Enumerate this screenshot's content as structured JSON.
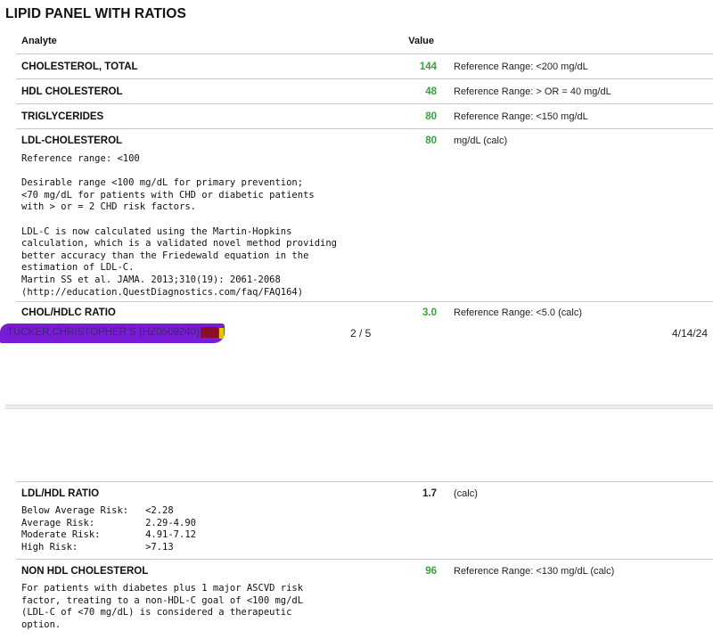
{
  "title": "LIPID PANEL WITH RATIOS",
  "header": {
    "analyte": "Analyte",
    "value": "Value"
  },
  "tests": [
    {
      "name": "CHOLESTEROL, TOTAL",
      "value": "144",
      "ref": "Reference Range: <200 mg/dL"
    },
    {
      "name": "HDL CHOLESTEROL",
      "value": "48",
      "ref": "Reference Range: > OR = 40 mg/dL"
    },
    {
      "name": "TRIGLYCERIDES",
      "value": "80",
      "ref": "Reference Range: <150 mg/dL"
    },
    {
      "name": "LDL-CHOLESTEROL",
      "value": "80",
      "ref": "mg/dL (calc)",
      "note": "Reference range: <100\n\nDesirable range <100 mg/dL for primary prevention;\n<70 mg/dL for patients with CHD or diabetic patients\nwith > or = 2 CHD risk factors.\n\nLDL-C is now calculated using the Martin-Hopkins\ncalculation, which is a validated novel method providing\nbetter accuracy than the Friedewald equation in the\nestimation of LDL-C.\nMartin SS et al. JAMA. 2013;310(19): 2061-2068\n(http://education.QuestDiagnostics.com/faq/FAQ164)"
    },
    {
      "name": "CHOL/HDLC RATIO",
      "value": "3.0",
      "ref": "Reference Range: <5.0 (calc)"
    },
    {
      "name": "LDL/HDL RATIO",
      "value": "1.7",
      "ref": "(calc)",
      "note": "Below Average Risk:   <2.28\nAverage Risk:         2.29-4.90\nModerate Risk:        4.91-7.12\nHigh Risk:            >7.13"
    },
    {
      "name": "NON HDL CHOLESTEROL",
      "value": "96",
      "ref": "Reference Range: <130 mg/dL (calc)",
      "note": "For patients with diabetes plus 1 major ASCVD risk\nfactor, treating to a non-HDL-C goal of <100 mg/dL\n(LDL-C of <70 mg/dL) is considered a therapeutic\noption."
    }
  ],
  "footer": {
    "patient": "TUCKER,CHRISTOPHER S (HZ0509240)",
    "page": "2 / 5",
    "date": "4/14/24"
  },
  "colors": {
    "normal_value": "#3aa13a",
    "redaction": "#7a1bd6"
  }
}
